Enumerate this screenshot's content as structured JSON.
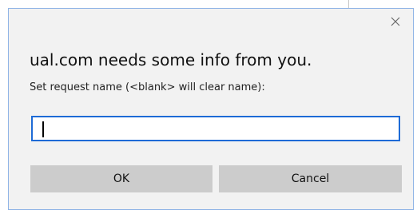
{
  "dialog": {
    "close_icon": "close-icon",
    "headline": "ual.com needs some info from you.",
    "prompt": "Set request name (<blank> will clear name):",
    "input": {
      "value": "",
      "placeholder": ""
    },
    "buttons": {
      "ok_label": "OK",
      "cancel_label": "Cancel"
    },
    "colors": {
      "dialog_bg": "#f2f2f2",
      "border_accent": "#8fb4e6",
      "input_focus_border": "#1e6bd6",
      "button_bg": "#cccccc"
    }
  }
}
